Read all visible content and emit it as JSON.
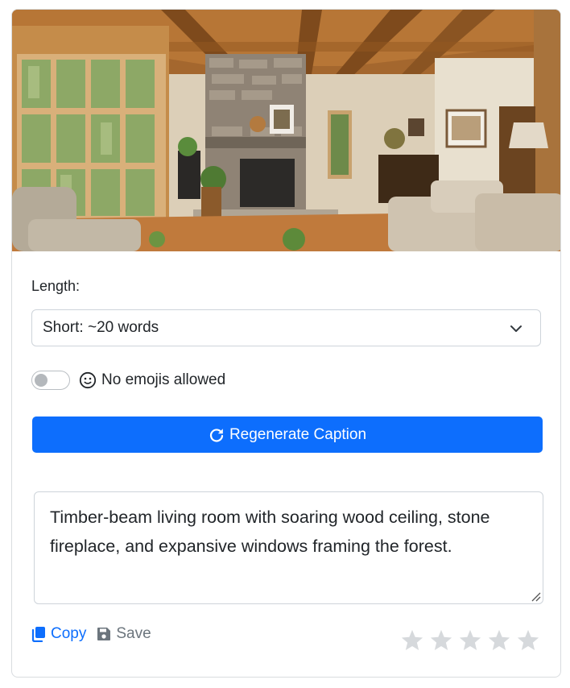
{
  "form": {
    "length_label": "Length:",
    "length_value": "Short: ~20 words",
    "emoji_toggle_on": false,
    "emoji_label": "No emojis allowed"
  },
  "regenerate_label": "Regenerate Caption",
  "caption_text": "Timber-beam living room with soaring wood ceiling, stone fireplace, and expansive windows framing the forest.",
  "actions": {
    "copy_label": "Copy",
    "save_label": "Save"
  },
  "rating": {
    "stars": 5,
    "selected": 0
  },
  "colors": {
    "primary": "#0d6efd",
    "muted": "#6c757d",
    "star": "#d6d9dc"
  },
  "icons": [
    "chevron-down-icon",
    "emoji-neutral-icon",
    "refresh-icon",
    "copy-icon",
    "save-icon",
    "star-icon",
    "resize-grip-icon"
  ]
}
